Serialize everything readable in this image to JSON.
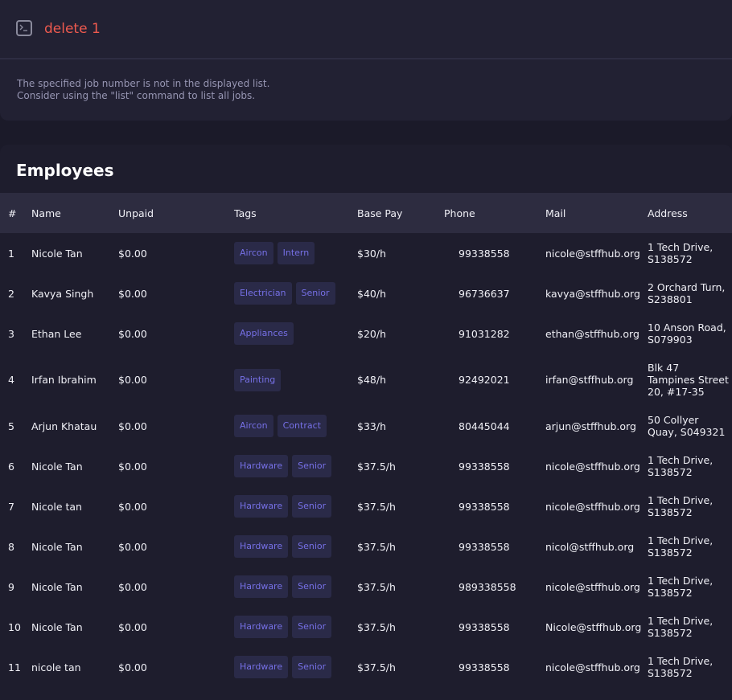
{
  "command": {
    "text": "delete 1",
    "icon": "terminal-icon"
  },
  "feedback": {
    "line1": "The specified job number is not in the displayed list.",
    "line2": "Consider using the \"list\" command to list all jobs."
  },
  "employees": {
    "title": "Employees",
    "columns": [
      "#",
      "Name",
      "Unpaid",
      "Tags",
      "Base Pay",
      "Phone",
      "Mail",
      "Address"
    ],
    "rows": [
      {
        "idx": "1",
        "name": "Nicole Tan",
        "unpaid": "$0.00",
        "tags": [
          "Aircon",
          "Intern"
        ],
        "base": "$30/h",
        "phone": "99338558",
        "mail": "nicole@stffhub.org",
        "address": "1 Tech Drive, S138572"
      },
      {
        "idx": "2",
        "name": "Kavya Singh",
        "unpaid": "$0.00",
        "tags": [
          "Electrician",
          "Senior"
        ],
        "base": "$40/h",
        "phone": "96736637",
        "mail": "kavya@stffhub.org",
        "address": "2 Orchard Turn, S238801"
      },
      {
        "idx": "3",
        "name": "Ethan Lee",
        "unpaid": "$0.00",
        "tags": [
          "Appliances"
        ],
        "base": "$20/h",
        "phone": "91031282",
        "mail": "ethan@stffhub.org",
        "address": "10 Anson Road, S079903"
      },
      {
        "idx": "4",
        "name": "Irfan Ibrahim",
        "unpaid": "$0.00",
        "tags": [
          "Painting"
        ],
        "base": "$48/h",
        "phone": "92492021",
        "mail": "irfan@stffhub.org",
        "address": "Blk 47 Tampines Street 20, #17-35"
      },
      {
        "idx": "5",
        "name": "Arjun Khatau",
        "unpaid": "$0.00",
        "tags": [
          "Aircon",
          "Contract"
        ],
        "base": "$33/h",
        "phone": "80445044",
        "mail": "arjun@stffhub.org",
        "address": "50 Collyer Quay, S049321"
      },
      {
        "idx": "6",
        "name": "Nicole Tan",
        "unpaid": "$0.00",
        "tags": [
          "Hardware",
          "Senior"
        ],
        "base": "$37.5/h",
        "phone": "99338558",
        "mail": "nicole@stffhub.org",
        "address": "1 Tech    Drive, S138572"
      },
      {
        "idx": "7",
        "name": "Nicole tan",
        "unpaid": "$0.00",
        "tags": [
          "Hardware",
          "Senior"
        ],
        "base": "$37.5/h",
        "phone": "99338558",
        "mail": "nicole@stffhub.org",
        "address": "1 Tech    Drive, S138572"
      },
      {
        "idx": "8",
        "name": "Nicole Tan",
        "unpaid": "$0.00",
        "tags": [
          "Hardware",
          "Senior"
        ],
        "base": "$37.5/h",
        "phone": "99338558",
        "mail": "nicol@stffhub.org",
        "address": "1 Tech    Drive, S138572"
      },
      {
        "idx": "9",
        "name": "Nicole Tan",
        "unpaid": "$0.00",
        "tags": [
          "Hardware",
          "Senior"
        ],
        "base": "$37.5/h",
        "phone": "989338558",
        "mail": "nicole@stffhub.org",
        "address": "1 Tech    Drive, S138572"
      },
      {
        "idx": "10",
        "name": "Nicole Tan",
        "unpaid": "$0.00",
        "tags": [
          "Hardware",
          "Senior"
        ],
        "base": "$37.5/h",
        "phone": "99338558",
        "mail": "Nicole@stffhub.org",
        "address": "1 Tech    Drive, S138572"
      },
      {
        "idx": "11",
        "name": "nicole tan",
        "unpaid": "$0.00",
        "tags": [
          "Hardware",
          "Senior"
        ],
        "base": "$37.5/h",
        "phone": "99338558",
        "mail": "nicole@stffhub.org",
        "address": "1 Tech    Drive, S138572"
      }
    ]
  }
}
